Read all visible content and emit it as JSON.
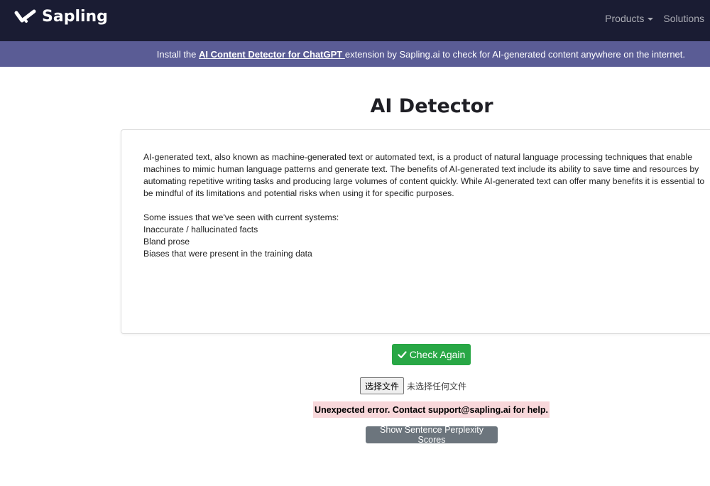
{
  "navbar": {
    "brand_name": "Sapling",
    "products_label": "Products",
    "solutions_label": "Solutions"
  },
  "banner": {
    "prefix": "Install the ",
    "link_text": "AI Content Detector for ChatGPT ",
    "suffix": " extension by Sapling.ai to check for AI-generated content anywhere on the internet."
  },
  "main": {
    "title": "AI Detector",
    "editor": {
      "paragraph": "AI-generated text, also known as machine-generated text or automated text, is a product of natural language processing techniques that enable machines to mimic human language patterns and generate text. The benefits of AI-generated text include its ability to save time and resources by automating repetitive writing tasks and producing large volumes of content quickly. While AI-generated text can offer many benefits it is essential to be mindful of its limitations and potential risks when using it for specific purposes.",
      "issues_heading": "Some issues that we've seen with current systems:",
      "issues": [
        "Inaccurate / hallucinated facts",
        "Bland prose",
        "Biases that were present in the training data"
      ]
    },
    "check_button_label": "Check Again",
    "file_input": {
      "button_label": "选择文件",
      "status_text": "未选择任何文件"
    },
    "error_message": "Unexpected error. Contact support@sapling.ai for help.",
    "perplexity_button_label": "Show Sentence Perplexity Scores"
  },
  "colors": {
    "navbar_bg": "#1a1c33",
    "banner_bg": "#5a5c95",
    "success": "#28a745",
    "error_bg": "#f8d7da",
    "secondary": "#6c757d"
  },
  "icons": {
    "brand": "sapling-logo-icon",
    "dropdown": "caret-down-icon",
    "check": "checkmark-icon"
  }
}
